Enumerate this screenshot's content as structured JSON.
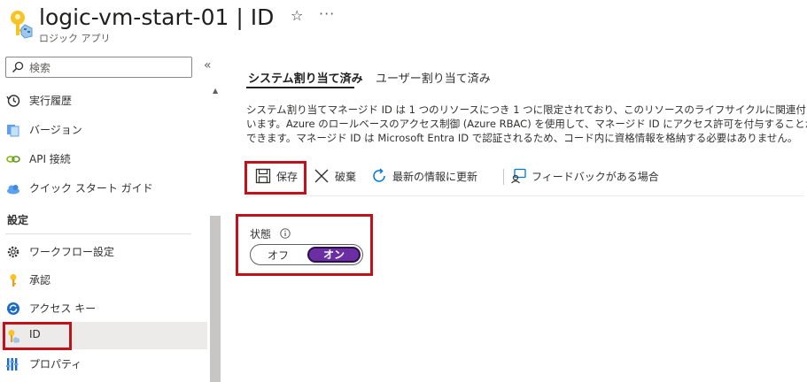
{
  "header": {
    "title": "logic-vm-start-01 | ID",
    "subtitle": "ロジック アプリ",
    "star_icon": "star-icon",
    "more_icon": "more-icon"
  },
  "sidebar": {
    "search_placeholder": "検索",
    "collapse_glyph": "«",
    "items_top": [
      {
        "label": "実行履歴",
        "icon": "history-icon"
      },
      {
        "label": "バージョン",
        "icon": "versions-icon"
      },
      {
        "label": "API 接続",
        "icon": "api-connection-icon"
      },
      {
        "label": "クイック スタート ガイド",
        "icon": "cloud-quickstart-icon"
      }
    ],
    "section_title": "設定",
    "items_settings": [
      {
        "label": "ワークフロー設定",
        "icon": "gear-icon"
      },
      {
        "label": "承認",
        "icon": "key-icon"
      },
      {
        "label": "アクセス キー",
        "icon": "refresh-key-icon"
      },
      {
        "label": "ID",
        "icon": "identity-key-icon",
        "selected": true
      },
      {
        "label": "プロパティ",
        "icon": "properties-icon"
      }
    ]
  },
  "main": {
    "tabs": [
      {
        "label": "システム割り当て済み",
        "active": true
      },
      {
        "label": "ユーザー割り当て済み",
        "active": false
      }
    ],
    "description": [
      "システム割り当てマネージド ID は 1 つのリソースにつき 1 つに限定されており、このリソースのライフサイクルに関連付けられて",
      "います。Azure のロールベースのアクセス制御 (Azure RBAC) を使用して、マネージド ID にアクセス許可を付与することが",
      "できます。マネージド ID は Microsoft Entra ID で認証されるため、コード内に資格情報を格納する必要はありません。"
    ],
    "toolbar": {
      "save": "保存",
      "discard": "破棄",
      "refresh": "最新の情報に更新",
      "feedback": "フィードバックがある場合"
    },
    "status": {
      "label": "状態",
      "off": "オフ",
      "on": "オン",
      "value": "on"
    }
  },
  "colors": {
    "highlight": "#c0121b",
    "toggle_on": "#6b2fa3",
    "accent_blue": "#0078d4"
  }
}
